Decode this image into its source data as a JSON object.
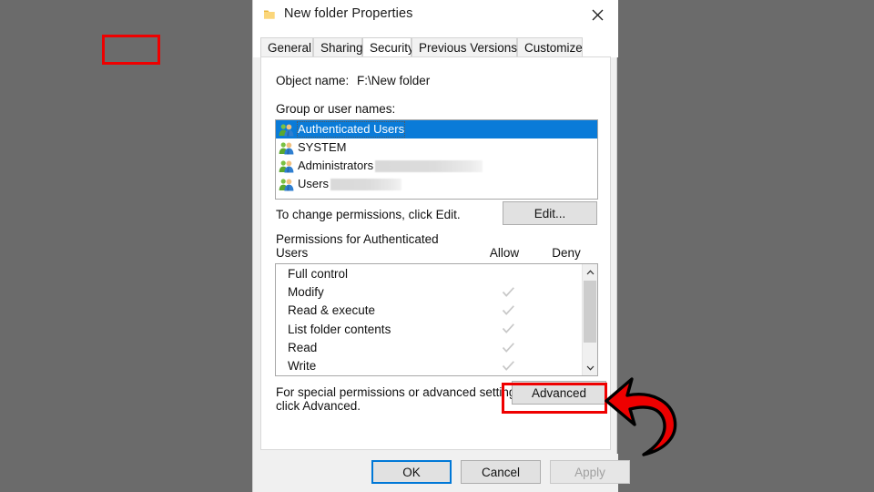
{
  "window": {
    "title": "New folder Properties",
    "folder_icon": "folder-icon",
    "close_icon": "close-icon"
  },
  "tabs": [
    {
      "label": "General",
      "active": false
    },
    {
      "label": "Sharing",
      "active": false
    },
    {
      "label": "Security",
      "active": true
    },
    {
      "label": "Previous Versions",
      "active": false
    },
    {
      "label": "Customize",
      "active": false
    }
  ],
  "security": {
    "object_name_label": "Object name:",
    "object_name_value": "F:\\New folder",
    "group_label": "Group or user names:",
    "group_list": [
      {
        "name": "Authenticated Users",
        "selected": true,
        "redacted_width": 0,
        "icon": "users-group-icon"
      },
      {
        "name": "SYSTEM",
        "selected": false,
        "redacted_width": 0,
        "icon": "users-group-icon"
      },
      {
        "name": "Administrators",
        "selected": false,
        "redacted_width": 118,
        "icon": "users-group-icon"
      },
      {
        "name": "Users",
        "selected": false,
        "redacted_width": 78,
        "icon": "users-group-icon"
      }
    ],
    "change_permissions_text": "To change permissions, click Edit.",
    "edit_button_label": "Edit...",
    "permissions_header_line1": "Permissions for Authenticated",
    "permissions_header_line2": "Users",
    "allow_column_header": "Allow",
    "deny_column_header": "Deny",
    "permissions": [
      {
        "name": "Full control",
        "allow": false,
        "deny": false
      },
      {
        "name": "Modify",
        "allow": true,
        "deny": false
      },
      {
        "name": "Read & execute",
        "allow": true,
        "deny": false
      },
      {
        "name": "List folder contents",
        "allow": true,
        "deny": false
      },
      {
        "name": "Read",
        "allow": true,
        "deny": false
      },
      {
        "name": "Write",
        "allow": true,
        "deny": false
      }
    ],
    "scrollbar": {
      "up_icon": "chevron-up-icon",
      "down_icon": "chevron-down-icon"
    },
    "special_permissions_line1": "For special permissions or advanced settings,",
    "special_permissions_line2": "click Advanced.",
    "advanced_button_label": "Advanced"
  },
  "footer": {
    "ok_label": "OK",
    "cancel_label": "Cancel",
    "apply_label": "Apply",
    "apply_disabled": true
  },
  "annotations": {
    "highlight_color": "#ef0000",
    "arrow_fill": "#ee0000",
    "arrow_stroke": "#000000",
    "arrow_icon": "curved-arrow-left-icon",
    "highlighted_tab": "Security",
    "highlighted_button": "Advanced"
  },
  "colors": {
    "desktop_background": "#6b6b6b",
    "dialog_background": "#f0f0f0",
    "selection_blue": "#0a7bd8",
    "focus_blue": "#0078d7"
  }
}
